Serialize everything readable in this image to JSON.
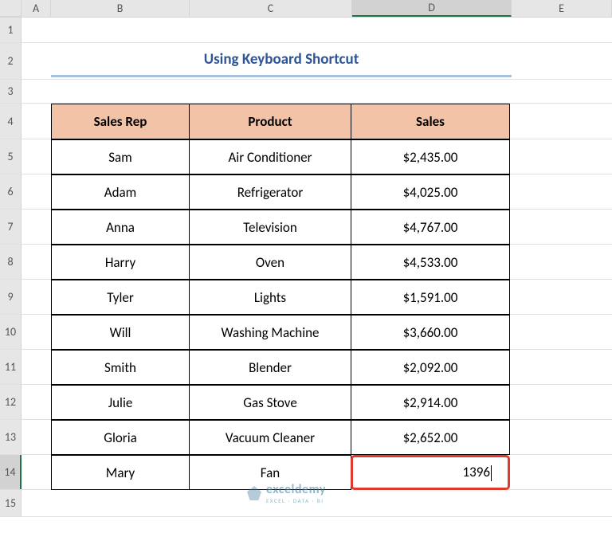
{
  "columns": [
    "A",
    "B",
    "C",
    "D",
    "E"
  ],
  "rownums": [
    "1",
    "2",
    "3",
    "4",
    "5",
    "6",
    "7",
    "8",
    "9",
    "10",
    "11",
    "12",
    "13",
    "14",
    "15"
  ],
  "title": "Using Keyboard Shortcut",
  "headers": {
    "b": "Sales Rep",
    "c": "Product",
    "d": "Sales"
  },
  "rows": [
    {
      "rep": "Sam",
      "product": "Air Conditioner",
      "sales": "$2,435.00"
    },
    {
      "rep": "Adam",
      "product": "Refrigerator",
      "sales": "$4,025.00"
    },
    {
      "rep": "Anna",
      "product": "Television",
      "sales": "$4,767.00"
    },
    {
      "rep": "Harry",
      "product": "Oven",
      "sales": "$4,533.00"
    },
    {
      "rep": "Tyler",
      "product": "Lights",
      "sales": "$1,591.00"
    },
    {
      "rep": "Will",
      "product": "Washing Machine",
      "sales": "$3,660.00"
    },
    {
      "rep": "Smith",
      "product": "Blender",
      "sales": "$2,092.00"
    },
    {
      "rep": "Julie",
      "product": "Gas Stove",
      "sales": "$2,914.00"
    },
    {
      "rep": "Gloria",
      "product": "Vacuum Cleaner",
      "sales": "$2,652.00"
    },
    {
      "rep": "Mary",
      "product": "Fan",
      "sales": "1396"
    }
  ],
  "selected_column": "D",
  "selected_row": "14",
  "watermark": {
    "brand": "exceldemy",
    "tagline": "EXCEL · DATA · BI"
  },
  "chart_data": {
    "type": "table",
    "title": "Using Keyboard Shortcut",
    "columns": [
      "Sales Rep",
      "Product",
      "Sales"
    ],
    "rows": [
      [
        "Sam",
        "Air Conditioner",
        2435.0
      ],
      [
        "Adam",
        "Refrigerator",
        4025.0
      ],
      [
        "Anna",
        "Television",
        4767.0
      ],
      [
        "Harry",
        "Oven",
        4533.0
      ],
      [
        "Tyler",
        "Lights",
        1591.0
      ],
      [
        "Will",
        "Washing Machine",
        3660.0
      ],
      [
        "Smith",
        "Blender",
        2092.0
      ],
      [
        "Julie",
        "Gas Stove",
        2914.0
      ],
      [
        "Gloria",
        "Vacuum Cleaner",
        2652.0
      ],
      [
        "Mary",
        "Fan",
        1396
      ]
    ]
  }
}
